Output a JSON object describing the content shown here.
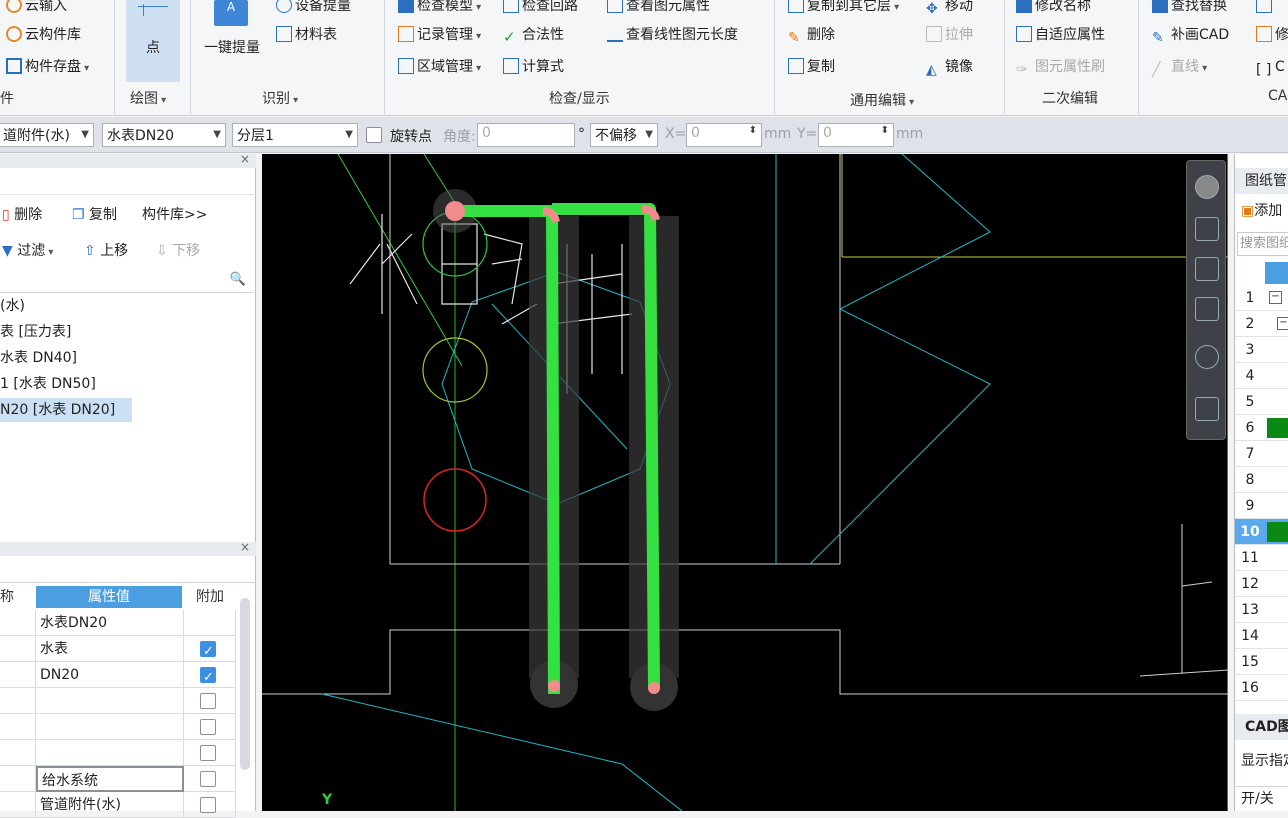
{
  "ribbon": {
    "cloud_input": "云输入",
    "cloud_lib": "云构件库",
    "save_comp": "构件存盘",
    "group_comp": "件",
    "point": "点",
    "group_draw": "绘图",
    "one_click": "一键提量",
    "device_qty": "设备提量",
    "material": "材料表",
    "group_identify": "识别",
    "check_model": "检查模型",
    "check_loop": "检查回路",
    "view_prop": "查看图元属性",
    "record_mgmt": "记录管理",
    "legality": "合法性",
    "view_len": "查看线性图元长度",
    "area_mgmt": "区域管理",
    "calc": "计算式",
    "group_check": "检查/显示",
    "copy_layer": "复制到其它层",
    "move": "移动",
    "delete": "删除",
    "stretch": "拉伸",
    "copy": "复制",
    "mirror": "镜像",
    "group_edit": "通用编辑",
    "rename": "修改名称",
    "adaptive": "自适应属性",
    "brush": "图元属性刷",
    "group_secondary": "二次编辑",
    "find_replace": "查找替换",
    "fill_cad": "补画CAD",
    "line": "直线",
    "group_cad": "CA",
    "cut1": "修",
    "cut2": "C"
  },
  "toolbar": {
    "type": "道附件(水)",
    "component": "水表DN20",
    "layer": "分层1",
    "rotate_label": "旋转点",
    "angle_label": "角度:",
    "angle_value": "0",
    "degree": "°",
    "offset": "不偏移",
    "x_label": "X=",
    "x_value": "0",
    "unit1": "mm",
    "y_label": "Y=",
    "y_value": "0",
    "unit2": "mm"
  },
  "left": {
    "delete": "删除",
    "copy": "复制",
    "lib": "构件库>>",
    "filter": "过滤",
    "up": "上移",
    "down": "下移",
    "tree": [
      "(水)",
      "表 [压力表]",
      "水表 DN40]",
      "1 [水表 DN50]",
      "N20 [水表 DN20]"
    ],
    "prop_header_name": "称",
    "prop_header_value": "属性值",
    "prop_header_extra": "附加",
    "props": [
      {
        "value": "水表DN20",
        "check": null
      },
      {
        "value": "水表",
        "check": true
      },
      {
        "value": "DN20",
        "check": true
      },
      {
        "value": "",
        "check": false
      },
      {
        "value": "",
        "check": false
      },
      {
        "value": "",
        "check": false
      },
      {
        "value": "给水系统",
        "check": false
      },
      {
        "value": "管道附件(水)",
        "check": false
      }
    ]
  },
  "right": {
    "title": "图纸管",
    "add": "添加",
    "search": "搜索图纸",
    "rows": [
      "1",
      "2",
      "3",
      "4",
      "5",
      "6",
      "7",
      "8",
      "9",
      "10",
      "11",
      "12",
      "13",
      "14",
      "15",
      "16"
    ],
    "cad_title": "CAD图",
    "show_label": "显示指定",
    "toggle": "开/关"
  },
  "canvas": {
    "y_axis": "Y"
  }
}
